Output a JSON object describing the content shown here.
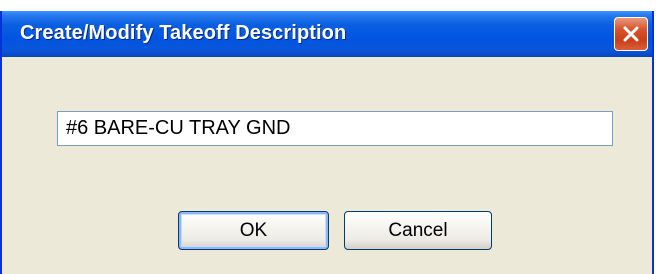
{
  "dialog": {
    "title": "Create/Modify Takeoff Description",
    "close_label": "Close",
    "description_value": "#6 BARE-CU TRAY GND",
    "ok_label": "OK",
    "cancel_label": "Cancel"
  },
  "icons": {
    "close": "close-icon"
  },
  "colors": {
    "titlebar": "#0054e3",
    "close_button": "#d9542c",
    "dialog_background": "#ece9d8",
    "field_border": "#7f9db9",
    "button_border": "#003c74"
  }
}
